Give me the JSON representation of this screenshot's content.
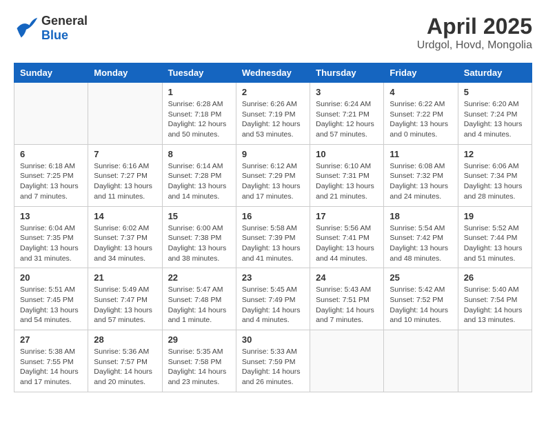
{
  "header": {
    "logo": {
      "general": "General",
      "blue": "Blue"
    },
    "title": "April 2025",
    "subtitle": "Urdgol, Hovd, Mongolia"
  },
  "days_of_week": [
    "Sunday",
    "Monday",
    "Tuesday",
    "Wednesday",
    "Thursday",
    "Friday",
    "Saturday"
  ],
  "weeks": [
    [
      {
        "day": "",
        "detail": ""
      },
      {
        "day": "",
        "detail": ""
      },
      {
        "day": "1",
        "detail": "Sunrise: 6:28 AM\nSunset: 7:18 PM\nDaylight: 12 hours and 50 minutes."
      },
      {
        "day": "2",
        "detail": "Sunrise: 6:26 AM\nSunset: 7:19 PM\nDaylight: 12 hours and 53 minutes."
      },
      {
        "day": "3",
        "detail": "Sunrise: 6:24 AM\nSunset: 7:21 PM\nDaylight: 12 hours and 57 minutes."
      },
      {
        "day": "4",
        "detail": "Sunrise: 6:22 AM\nSunset: 7:22 PM\nDaylight: 13 hours and 0 minutes."
      },
      {
        "day": "5",
        "detail": "Sunrise: 6:20 AM\nSunset: 7:24 PM\nDaylight: 13 hours and 4 minutes."
      }
    ],
    [
      {
        "day": "6",
        "detail": "Sunrise: 6:18 AM\nSunset: 7:25 PM\nDaylight: 13 hours and 7 minutes."
      },
      {
        "day": "7",
        "detail": "Sunrise: 6:16 AM\nSunset: 7:27 PM\nDaylight: 13 hours and 11 minutes."
      },
      {
        "day": "8",
        "detail": "Sunrise: 6:14 AM\nSunset: 7:28 PM\nDaylight: 13 hours and 14 minutes."
      },
      {
        "day": "9",
        "detail": "Sunrise: 6:12 AM\nSunset: 7:29 PM\nDaylight: 13 hours and 17 minutes."
      },
      {
        "day": "10",
        "detail": "Sunrise: 6:10 AM\nSunset: 7:31 PM\nDaylight: 13 hours and 21 minutes."
      },
      {
        "day": "11",
        "detail": "Sunrise: 6:08 AM\nSunset: 7:32 PM\nDaylight: 13 hours and 24 minutes."
      },
      {
        "day": "12",
        "detail": "Sunrise: 6:06 AM\nSunset: 7:34 PM\nDaylight: 13 hours and 28 minutes."
      }
    ],
    [
      {
        "day": "13",
        "detail": "Sunrise: 6:04 AM\nSunset: 7:35 PM\nDaylight: 13 hours and 31 minutes."
      },
      {
        "day": "14",
        "detail": "Sunrise: 6:02 AM\nSunset: 7:37 PM\nDaylight: 13 hours and 34 minutes."
      },
      {
        "day": "15",
        "detail": "Sunrise: 6:00 AM\nSunset: 7:38 PM\nDaylight: 13 hours and 38 minutes."
      },
      {
        "day": "16",
        "detail": "Sunrise: 5:58 AM\nSunset: 7:39 PM\nDaylight: 13 hours and 41 minutes."
      },
      {
        "day": "17",
        "detail": "Sunrise: 5:56 AM\nSunset: 7:41 PM\nDaylight: 13 hours and 44 minutes."
      },
      {
        "day": "18",
        "detail": "Sunrise: 5:54 AM\nSunset: 7:42 PM\nDaylight: 13 hours and 48 minutes."
      },
      {
        "day": "19",
        "detail": "Sunrise: 5:52 AM\nSunset: 7:44 PM\nDaylight: 13 hours and 51 minutes."
      }
    ],
    [
      {
        "day": "20",
        "detail": "Sunrise: 5:51 AM\nSunset: 7:45 PM\nDaylight: 13 hours and 54 minutes."
      },
      {
        "day": "21",
        "detail": "Sunrise: 5:49 AM\nSunset: 7:47 PM\nDaylight: 13 hours and 57 minutes."
      },
      {
        "day": "22",
        "detail": "Sunrise: 5:47 AM\nSunset: 7:48 PM\nDaylight: 14 hours and 1 minute."
      },
      {
        "day": "23",
        "detail": "Sunrise: 5:45 AM\nSunset: 7:49 PM\nDaylight: 14 hours and 4 minutes."
      },
      {
        "day": "24",
        "detail": "Sunrise: 5:43 AM\nSunset: 7:51 PM\nDaylight: 14 hours and 7 minutes."
      },
      {
        "day": "25",
        "detail": "Sunrise: 5:42 AM\nSunset: 7:52 PM\nDaylight: 14 hours and 10 minutes."
      },
      {
        "day": "26",
        "detail": "Sunrise: 5:40 AM\nSunset: 7:54 PM\nDaylight: 14 hours and 13 minutes."
      }
    ],
    [
      {
        "day": "27",
        "detail": "Sunrise: 5:38 AM\nSunset: 7:55 PM\nDaylight: 14 hours and 17 minutes."
      },
      {
        "day": "28",
        "detail": "Sunrise: 5:36 AM\nSunset: 7:57 PM\nDaylight: 14 hours and 20 minutes."
      },
      {
        "day": "29",
        "detail": "Sunrise: 5:35 AM\nSunset: 7:58 PM\nDaylight: 14 hours and 23 minutes."
      },
      {
        "day": "30",
        "detail": "Sunrise: 5:33 AM\nSunset: 7:59 PM\nDaylight: 14 hours and 26 minutes."
      },
      {
        "day": "",
        "detail": ""
      },
      {
        "day": "",
        "detail": ""
      },
      {
        "day": "",
        "detail": ""
      }
    ]
  ]
}
